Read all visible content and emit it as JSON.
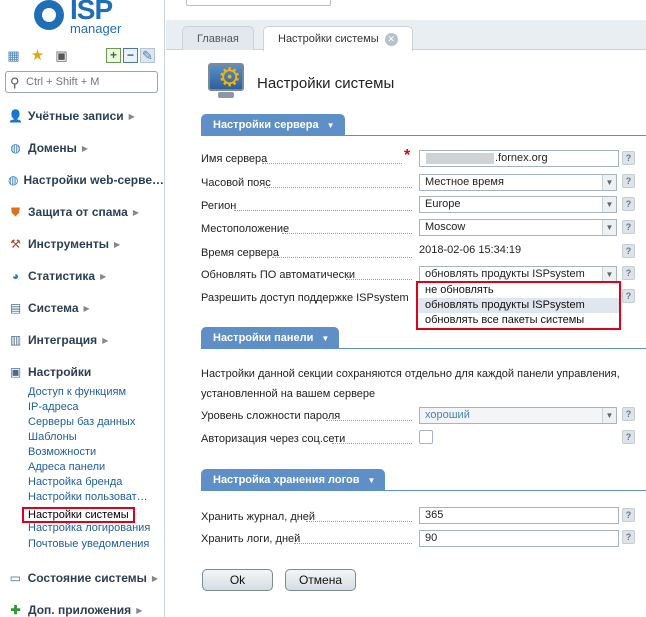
{
  "logo": {
    "isp": "ISP",
    "manager": "manager"
  },
  "sidebar": {
    "search_placeholder": "Ctrl + Shift + M",
    "groups": [
      {
        "label": "Учётные записи"
      },
      {
        "label": "Домены"
      },
      {
        "label": "Настройки web-серве…"
      },
      {
        "label": "Защита от спама"
      },
      {
        "label": "Инструменты"
      },
      {
        "label": "Статистика"
      },
      {
        "label": "Система"
      },
      {
        "label": "Интеграция"
      },
      {
        "label": "Настройки"
      },
      {
        "label": "Состояние системы"
      },
      {
        "label": "Доп. приложения"
      }
    ],
    "settings_items": [
      "Доступ к функциям",
      "IP-адреса",
      "Серверы баз данных",
      "Шаблоны",
      "Возможности",
      "Адреса панели",
      "Настройка бренда",
      "Настройки пользоват…",
      "Настройки системы",
      "Настройка логирования",
      "Почтовые уведомления"
    ]
  },
  "tabs": [
    {
      "label": "Главная"
    },
    {
      "label": "Настройки системы"
    }
  ],
  "page": {
    "title": "Настройки системы"
  },
  "sections": {
    "server": "Настройки сервера",
    "panel": "Настройки панели",
    "logs": "Настройка хранения логов"
  },
  "fields": {
    "server_name": {
      "label": "Имя сервера",
      "value": ".fornex.org"
    },
    "timezone": {
      "label": "Часовой пояс",
      "value": "Местное время"
    },
    "region": {
      "label": "Регион",
      "value": "Europe"
    },
    "location": {
      "label": "Местоположение",
      "value": "Moscow"
    },
    "server_time": {
      "label": "Время сервера",
      "value": "2018-02-06 15:34:19"
    },
    "auto_update": {
      "label": "Обновлять ПО автоматически",
      "value": "обновлять продукты ISPsystem"
    },
    "support_access": {
      "label": "Разрешить доступ поддержке ISPsystem"
    },
    "panel_note": "Настройки данной секции сохраняются отдельно для каждой панели управления, установленной на вашем сервере",
    "password_level": {
      "label": "Уровень сложности пароля",
      "value": "хороший"
    },
    "social_auth": {
      "label": "Авторизация через соц.сети"
    },
    "keep_journal": {
      "label": "Хранить журнал, дней",
      "value": "365"
    },
    "keep_logs": {
      "label": "Хранить логи, дней",
      "value": "90"
    }
  },
  "update_options": [
    "не обновлять",
    "обновлять продукты ISPsystem",
    "обновлять все пакеты системы"
  ],
  "help_glyph": "?",
  "required_glyph": "*",
  "buttons": {
    "ok": "Ok",
    "cancel": "Отмена"
  },
  "colors": {
    "accent": "#5e8fc6",
    "highlight": "#e0001b",
    "link": "#1f5e9e"
  }
}
